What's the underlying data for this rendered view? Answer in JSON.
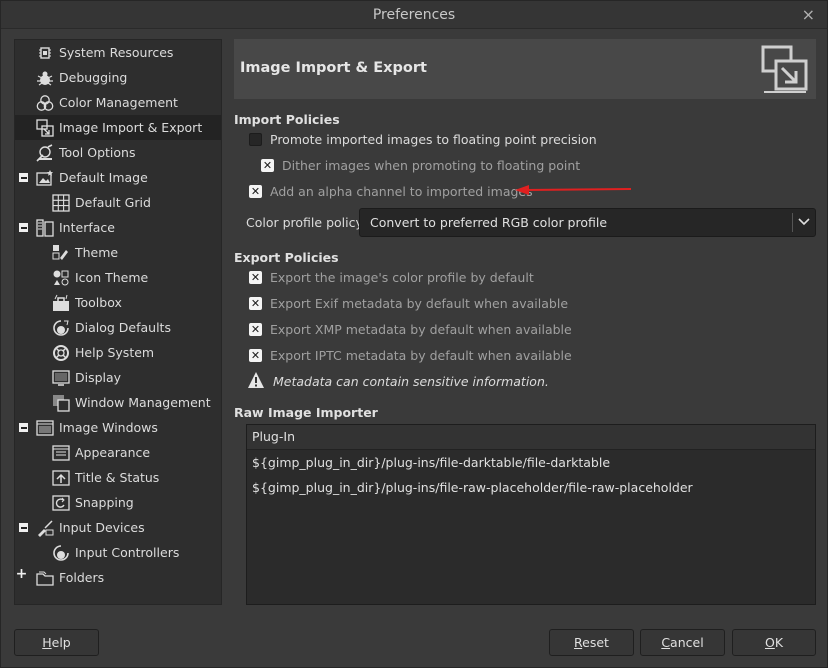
{
  "window": {
    "title": "Preferences",
    "close_glyph": "×"
  },
  "sidebar": {
    "items": [
      {
        "label": "System Resources",
        "icon": "chip-icon"
      },
      {
        "label": "Debugging",
        "icon": "bug-icon"
      },
      {
        "label": "Color Management",
        "icon": "color-circles-icon"
      },
      {
        "label": "Image Import & Export",
        "icon": "import-export-icon",
        "selected": true
      },
      {
        "label": "Tool Options",
        "icon": "tool-options-icon"
      },
      {
        "label": "Default Image",
        "icon": "default-image-icon",
        "expander": "minus"
      },
      {
        "label": "Default Grid",
        "icon": "grid-icon"
      },
      {
        "label": "Interface",
        "icon": "interface-icon",
        "expander": "minus"
      },
      {
        "label": "Theme",
        "icon": "theme-icon"
      },
      {
        "label": "Icon Theme",
        "icon": "icon-theme-icon"
      },
      {
        "label": "Toolbox",
        "icon": "toolbox-icon"
      },
      {
        "label": "Dialog Defaults",
        "icon": "dialog-defaults-icon"
      },
      {
        "label": "Help System",
        "icon": "lifebuoy-icon"
      },
      {
        "label": "Display",
        "icon": "display-icon"
      },
      {
        "label": "Window Management",
        "icon": "window-management-icon"
      },
      {
        "label": "Image Windows",
        "icon": "image-windows-icon",
        "expander": "minus"
      },
      {
        "label": "Appearance",
        "icon": "appearance-icon"
      },
      {
        "label": "Title & Status",
        "icon": "title-status-icon"
      },
      {
        "label": "Snapping",
        "icon": "snapping-icon"
      },
      {
        "label": "Input Devices",
        "icon": "input-devices-icon",
        "expander": "minus"
      },
      {
        "label": "Input Controllers",
        "icon": "input-controllers-icon"
      },
      {
        "label": "Folders",
        "icon": "folders-icon",
        "expander": "plus"
      }
    ]
  },
  "header": {
    "title": "Image Import & Export"
  },
  "import_policies": {
    "title": "Import Policies",
    "promote": "Promote imported images to floating point precision",
    "dither": "Dither images when promoting to floating point",
    "alpha": "Add an alpha channel to imported images",
    "color_profile_label": "Color profile policy:",
    "color_profile_value": "Convert to preferred RGB color profile"
  },
  "export_policies": {
    "title": "Export Policies",
    "color_profile": "Export the image's color profile by default",
    "exif": "Export Exif metadata by default when available",
    "xmp": "Export XMP metadata by default when available",
    "iptc": "Export IPTC metadata by default when available",
    "warning": "Metadata can contain sensitive information."
  },
  "raw_importer": {
    "title": "Raw Image Importer",
    "column": "Plug-In",
    "rows": [
      "${gimp_plug_in_dir}/plug-ins/file-darktable/file-darktable",
      "${gimp_plug_in_dir}/plug-ins/file-raw-placeholder/file-raw-placeholder"
    ]
  },
  "buttons": {
    "help": {
      "mnemonic": "H",
      "rest": "elp"
    },
    "reset": {
      "mnemonic": "R",
      "rest": "eset"
    },
    "cancel": {
      "mnemonic": "C",
      "rest": "ancel"
    },
    "ok": {
      "mnemonic": "O",
      "rest": "K"
    }
  },
  "colors": {
    "annotation_arrow": "#e02020",
    "accent_bg": "#232323"
  }
}
